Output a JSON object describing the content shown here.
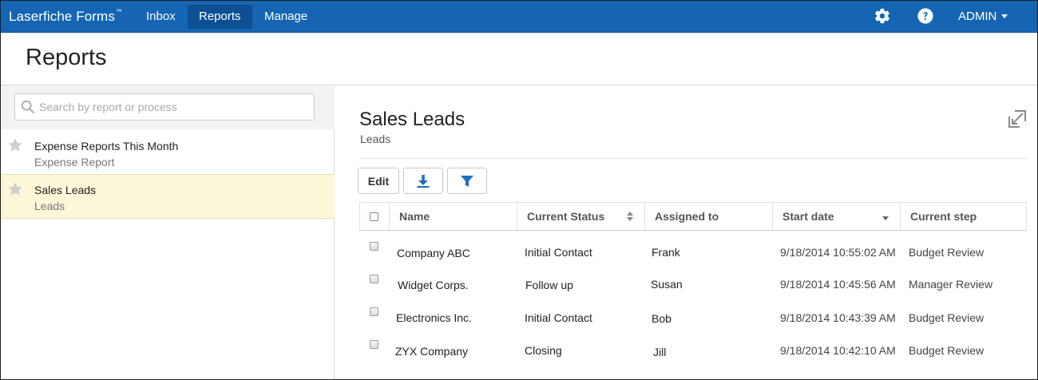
{
  "app": {
    "brand": "Laserfiche Forms",
    "brand_tm": "™"
  },
  "topnav": {
    "items": [
      {
        "label": "Inbox",
        "active": false
      },
      {
        "label": "Reports",
        "active": true
      },
      {
        "label": "Manage",
        "active": false
      }
    ],
    "settings_icon": "gear-icon",
    "help_icon": "help-circle-icon",
    "user_label": "ADMIN"
  },
  "page": {
    "title": "Reports"
  },
  "sidebar": {
    "search": {
      "placeholder": "Search by report or process",
      "value": ""
    },
    "reports": [
      {
        "name": "Expense Reports This Month",
        "process": "Expense Report",
        "selected": false
      },
      {
        "name": "Sales Leads",
        "process": "Leads",
        "selected": true
      }
    ]
  },
  "main": {
    "title": "Sales Leads",
    "subtitle": "Leads",
    "toolbar": {
      "edit_label": "Edit",
      "download_icon": "download-icon",
      "filter_icon": "filter-icon"
    },
    "table": {
      "columns": [
        {
          "label": "Name"
        },
        {
          "label": "Current Status",
          "sort": "both"
        },
        {
          "label": "Assigned to"
        },
        {
          "label": "Start date",
          "sort": "desc"
        },
        {
          "label": "Current step"
        }
      ],
      "rows": [
        {
          "name": "Company ABC",
          "status": "Initial Contact",
          "assigned": "Frank",
          "date": "9/18/2014 10:55:02 AM",
          "step": "Budget Review",
          "checked": false
        },
        {
          "name": "Widget Corps.",
          "status": "Follow up",
          "assigned": "Susan",
          "date": "9/18/2014 10:45:56 AM",
          "step": "Manager Review",
          "checked": false
        },
        {
          "name": "Electronics Inc.",
          "status": "Initial Contact",
          "assigned": "Bob",
          "date": "9/18/2014 10:43:39 AM",
          "step": "Budget Review",
          "checked": false
        },
        {
          "name": "ZYX Company",
          "status": "Closing",
          "assigned": "Jill",
          "date": "9/18/2014 10:42:10 AM",
          "step": "Budget Review",
          "checked": false
        }
      ]
    }
  },
  "colors": {
    "nav_bg": "#1565b3",
    "nav_active": "#0d4f92",
    "accent": "#1565b3",
    "selected_row": "#fdf7d9"
  }
}
